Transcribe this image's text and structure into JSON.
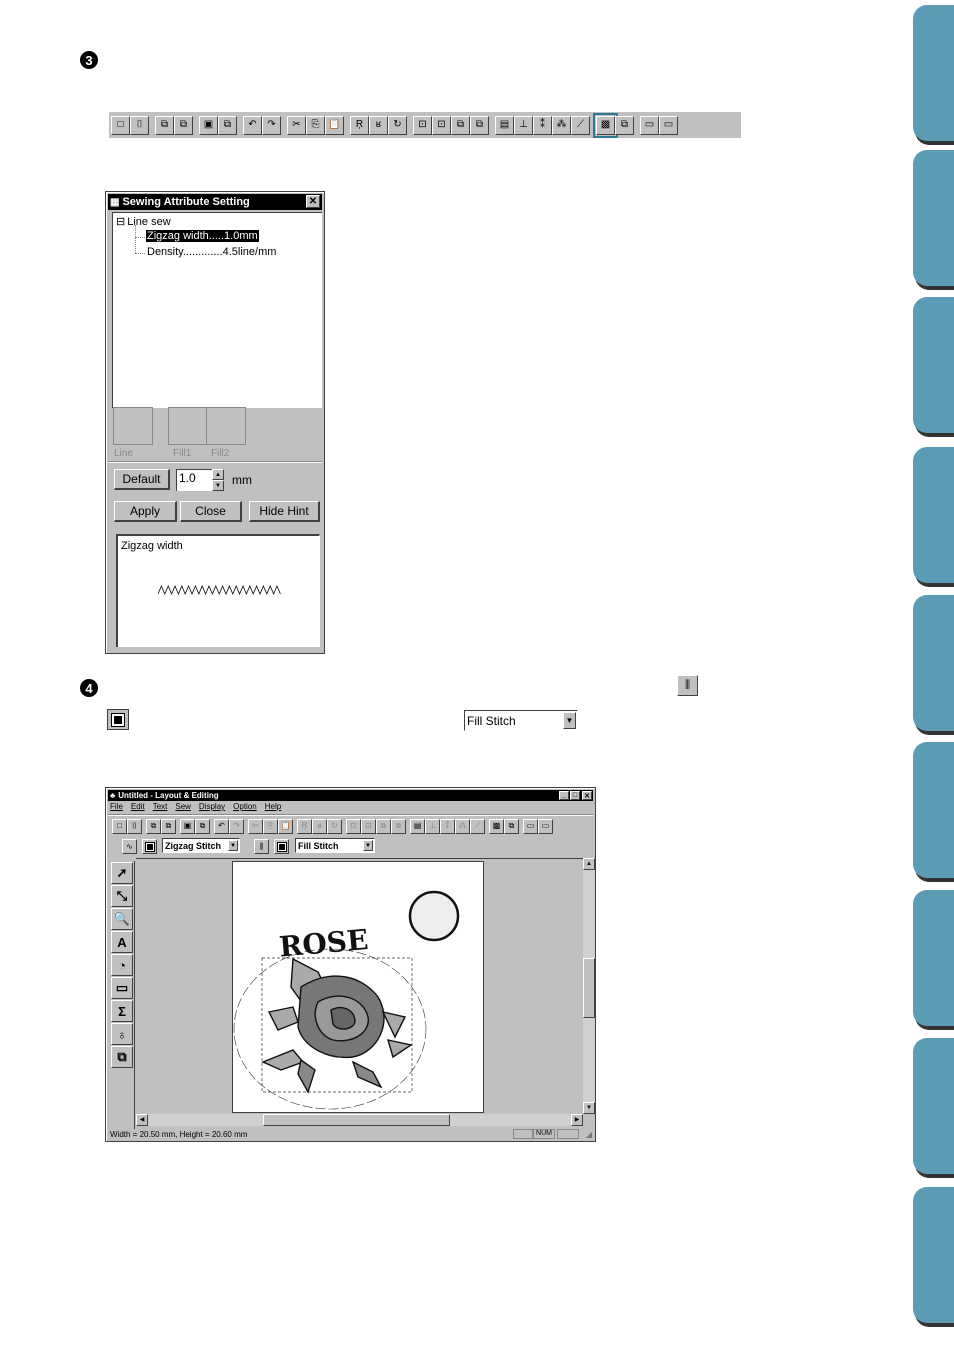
{
  "steps": [
    {
      "number": "3"
    },
    {
      "number": "4"
    }
  ],
  "toolbar_icons": [
    "new-file-icon",
    "open-file-icon",
    "import-icon",
    "export-icon",
    "save-icon",
    "save-as-icon",
    "undo-icon",
    "redo-icon",
    "cut-icon",
    "copy-icon",
    "paste-icon",
    "mirror-icon",
    "flip-icon",
    "rotate-icon",
    "group-icon",
    "ungroup-icon",
    "order-front-icon",
    "order-back-icon",
    "text-attribute-icon",
    "fit-text-icon",
    "text-vertical-icon",
    "text-arc-icon",
    "text-slant-icon",
    "sewing-attribute-icon",
    "sewing-order-icon",
    "preview-icon",
    "realistic-preview-icon"
  ],
  "toolbar_glyphs": [
    "□",
    "⌷",
    "⧉",
    "⧉",
    "▣",
    "⧉",
    "↶",
    "↷",
    "✂",
    "⎘",
    "📋",
    "Ŗ",
    "ʁ",
    "↻",
    "⊡",
    "⊡",
    "⧉",
    "⧉",
    "▤",
    "⊥",
    "⁑",
    "⁂",
    "⟋",
    "▩",
    "⧉",
    "▭",
    "▭"
  ],
  "dialog": {
    "title": "Sewing Attribute Setting",
    "close": "✕",
    "tree": {
      "root": "Line sew",
      "expander": "⊟",
      "items": [
        {
          "label": "Zigzag width.....1.0mm",
          "selected": true
        },
        {
          "label": "Density.............4.5line/mm",
          "selected": false
        }
      ]
    },
    "swatches": [
      "Line",
      "Fill1",
      "Fill2"
    ],
    "default_label": "Default",
    "value": "1.0",
    "unit": "mm",
    "apply_label": "Apply",
    "close_label": "Close",
    "hide_hint_label": "Hide Hint",
    "hint_title": "Zigzag width"
  },
  "inline": {
    "fill_stitch_select": "Fill Stitch"
  },
  "app": {
    "title": "Untitled - Layout & Editing",
    "menus": [
      "File",
      "Edit",
      "Text",
      "Sew",
      "Display",
      "Option",
      "Help"
    ],
    "line_sew_select": "Zigzag Stitch",
    "region_sew_select": "Fill Stitch",
    "canvas_text": "ROSE",
    "status": "Width  = 20.50 mm, Height = 20.60 mm",
    "status_num": "NUM",
    "tools": [
      "select-icon",
      "point-edit-icon",
      "zoom-icon",
      "text-icon",
      "outline-icon",
      "shape-icon",
      "manual-punch-icon",
      "stamp-icon",
      "import-icon"
    ],
    "tool_glyphs": [
      "➚",
      "⤡",
      "🔍",
      "A",
      "◔",
      "▭",
      "Σ",
      "♁",
      "⧉"
    ]
  },
  "side_tabs": 9
}
